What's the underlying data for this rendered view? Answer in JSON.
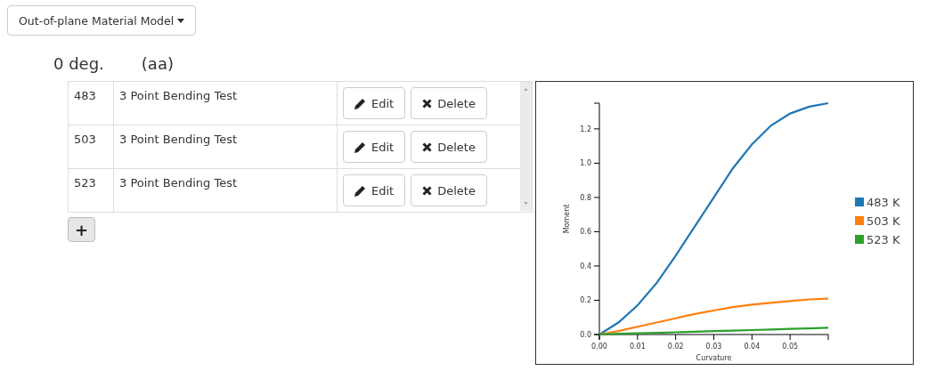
{
  "dropdown": {
    "label": "Out-of-plane Material Model"
  },
  "heading": {
    "angle": "0 deg.",
    "code": "(aa)"
  },
  "table": {
    "rows": [
      {
        "temperature": "483",
        "test": "3 Point Bending Test",
        "edit": "Edit",
        "delete": "Delete"
      },
      {
        "temperature": "503",
        "test": "3 Point Bending Test",
        "edit": "Edit",
        "delete": "Delete"
      },
      {
        "temperature": "523",
        "test": "3 Point Bending Test",
        "edit": "Edit",
        "delete": "Delete"
      }
    ]
  },
  "add_button": {
    "label": "+"
  },
  "chart_data": {
    "type": "line",
    "xlabel": "Curvature",
    "ylabel": "Moment",
    "x": [
      0,
      0.005,
      0.01,
      0.015,
      0.02,
      0.025,
      0.03,
      0.035,
      0.04,
      0.045,
      0.05,
      0.055,
      0.06
    ],
    "series": [
      {
        "name": "483 K",
        "color": "#1f77b4",
        "values": [
          0,
          0.07,
          0.17,
          0.3,
          0.46,
          0.63,
          0.8,
          0.97,
          1.11,
          1.22,
          1.29,
          1.33,
          1.35
        ]
      },
      {
        "name": "503 K",
        "color": "#ff7f0e",
        "values": [
          0,
          0.02,
          0.045,
          0.07,
          0.095,
          0.12,
          0.14,
          0.16,
          0.175,
          0.185,
          0.195,
          0.205,
          0.21
        ]
      },
      {
        "name": "523 K",
        "color": "#2ca02c",
        "values": [
          0,
          0.004,
          0.007,
          0.01,
          0.013,
          0.016,
          0.02,
          0.023,
          0.026,
          0.029,
          0.033,
          0.036,
          0.04
        ]
      }
    ],
    "legend": "right",
    "xlim": [
      0,
      0.06
    ],
    "ylim": [
      0,
      1.35
    ],
    "xticks": [
      {
        "value": 0,
        "label": "0.00"
      },
      {
        "value": 0.01,
        "label": "0.01"
      },
      {
        "value": 0.02,
        "label": "0.02"
      },
      {
        "value": 0.03,
        "label": "0.03"
      },
      {
        "value": 0.04,
        "label": "0.04"
      },
      {
        "value": 0.05,
        "label": "0.05"
      }
    ],
    "yticks": [
      {
        "value": 0,
        "label": "0.0"
      },
      {
        "value": 0.2,
        "label": "0.2"
      },
      {
        "value": 0.4,
        "label": "0.4"
      },
      {
        "value": 0.6,
        "label": "0.6"
      },
      {
        "value": 0.8,
        "label": "0.8"
      },
      {
        "value": 1.0,
        "label": "1.0"
      },
      {
        "value": 1.2,
        "label": "1.2"
      }
    ]
  }
}
